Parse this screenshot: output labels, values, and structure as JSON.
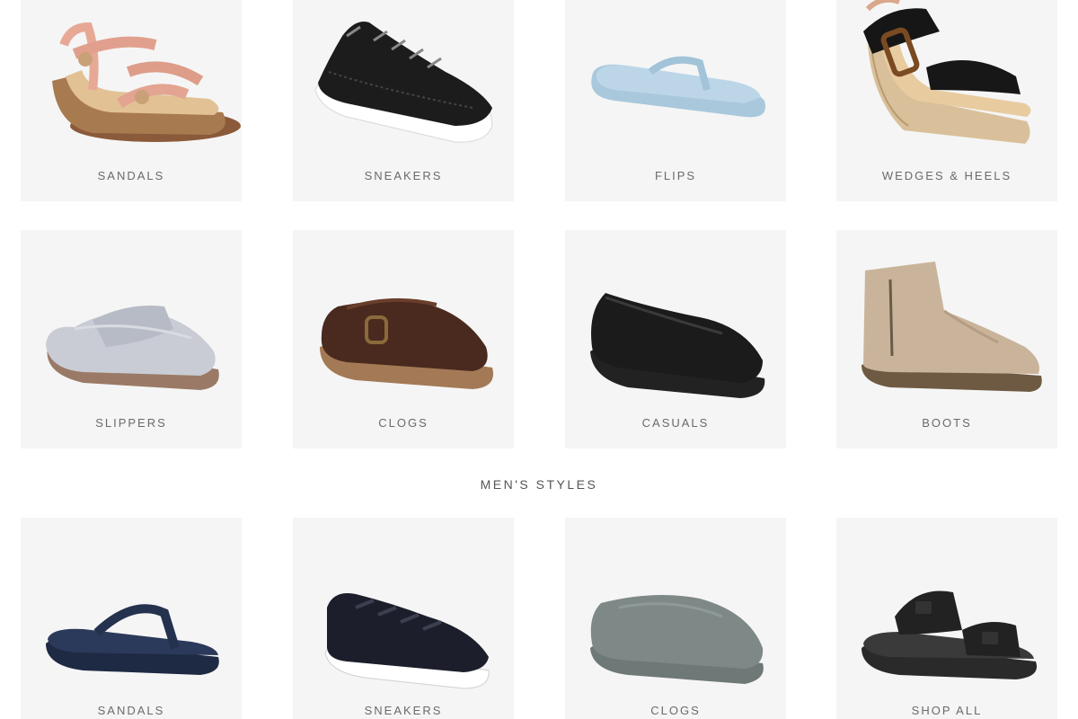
{
  "womens": {
    "row1": [
      {
        "label": "SANDALS",
        "icon": "womens-sandal-icon"
      },
      {
        "label": "SNEAKERS",
        "icon": "womens-sneaker-icon"
      },
      {
        "label": "FLIPS",
        "icon": "flip-flop-icon"
      },
      {
        "label": "WEDGES & HEELS",
        "icon": "wedge-sandal-icon"
      }
    ],
    "row2": [
      {
        "label": "SLIPPERS",
        "icon": "slipper-icon"
      },
      {
        "label": "CLOGS",
        "icon": "womens-clog-icon"
      },
      {
        "label": "CASUALS",
        "icon": "flat-shoe-icon"
      },
      {
        "label": "BOOTS",
        "icon": "ankle-boot-icon"
      }
    ]
  },
  "mens": {
    "title": "MEN'S STYLES",
    "items": [
      {
        "label": "SANDALS",
        "icon": "mens-thong-sandal-icon"
      },
      {
        "label": "SNEAKERS",
        "icon": "mens-sneaker-icon"
      },
      {
        "label": "CLOGS",
        "icon": "mens-clog-icon"
      },
      {
        "label": "SHOP ALL",
        "icon": "slide-sandal-icon"
      }
    ]
  },
  "colors": {
    "card_bg": "#f5f5f5",
    "label": "#6a6a6a"
  }
}
